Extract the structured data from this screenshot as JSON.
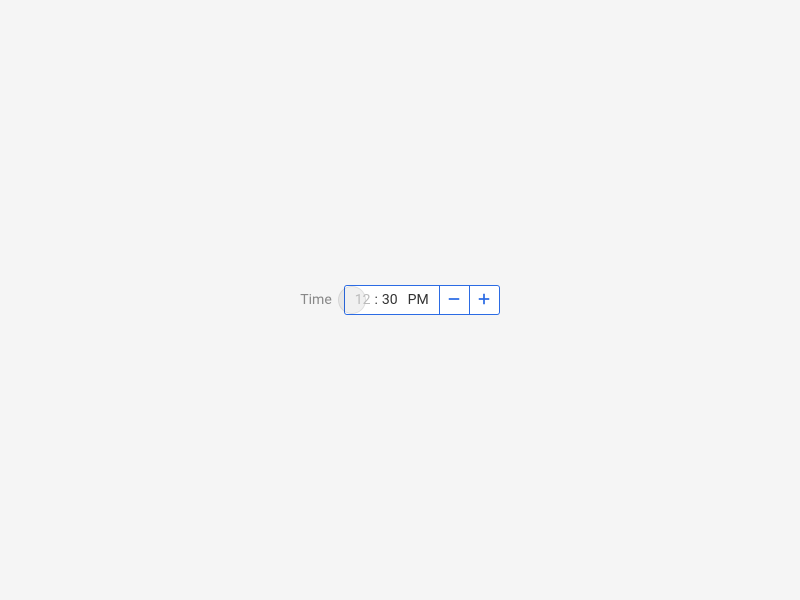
{
  "timePicker": {
    "label": "Time",
    "hour": "12",
    "separator": ":",
    "minute": "30",
    "period": "PM"
  },
  "colors": {
    "accent": "#2b6be4"
  }
}
